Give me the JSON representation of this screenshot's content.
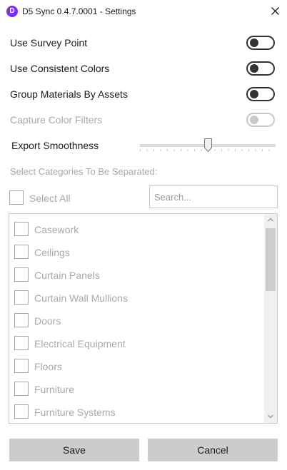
{
  "window": {
    "app_icon_letter": "D",
    "title": "D5 Sync 0.4.7.0001 - Settings",
    "close_icon": "close-icon"
  },
  "options": [
    {
      "label": "Use Survey Point",
      "enabled": true,
      "value": false
    },
    {
      "label": "Use Consistent Colors",
      "enabled": true,
      "value": false
    },
    {
      "label": "Group Materials By Assets",
      "enabled": true,
      "value": false
    },
    {
      "label": "Capture Color Filters",
      "enabled": false,
      "value": false
    }
  ],
  "smoothness": {
    "label": "Export Smoothness",
    "value": 0.5
  },
  "categories": {
    "section_label": "Select Categories To Be Separated:",
    "select_all_label": "Select All",
    "select_all_checked": false,
    "search_placeholder": "Search...",
    "search_value": "",
    "items": [
      {
        "label": "Casework",
        "checked": false
      },
      {
        "label": "Ceilings",
        "checked": false
      },
      {
        "label": "Curtain Panels",
        "checked": false
      },
      {
        "label": "Curtain Wall Mullions",
        "checked": false
      },
      {
        "label": "Doors",
        "checked": false
      },
      {
        "label": "Electrical Equipment",
        "checked": false
      },
      {
        "label": "Floors",
        "checked": false
      },
      {
        "label": "Furniture",
        "checked": false
      },
      {
        "label": "Furniture Systems",
        "checked": false
      }
    ]
  },
  "buttons": {
    "save_label": "Save",
    "cancel_label": "Cancel"
  },
  "colors": {
    "accent": "#7b2ff2",
    "toggle_on": "#333333",
    "disabled_text": "#a9a9a9",
    "button_bg": "#cccccc"
  }
}
